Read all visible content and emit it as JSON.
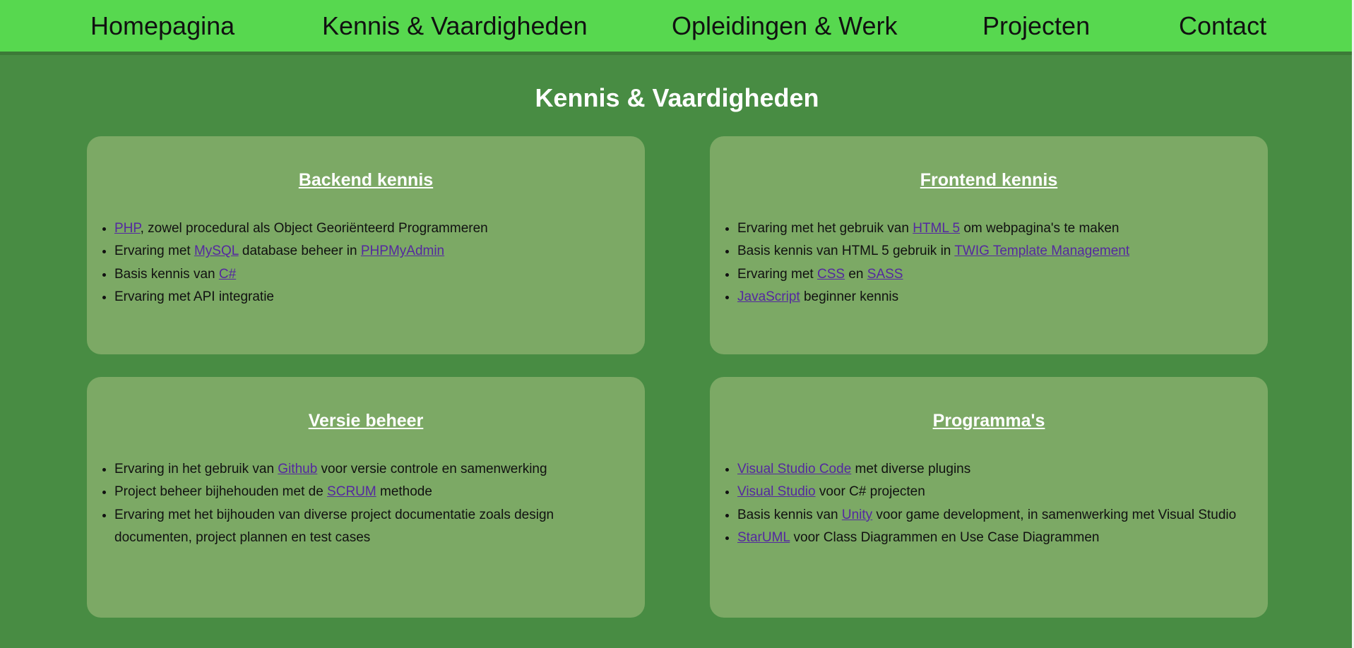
{
  "nav": {
    "items": [
      {
        "label": "Homepagina"
      },
      {
        "label": "Kennis & Vaardigheden"
      },
      {
        "label": "Opleidingen & Werk"
      },
      {
        "label": "Projecten"
      },
      {
        "label": "Contact"
      }
    ]
  },
  "page": {
    "title": "Kennis & Vaardigheden"
  },
  "cards": {
    "backend": {
      "title": "Backend kennis",
      "items": [
        {
          "link": "PHP",
          "text": ", zowel procedural als Object Georiënteerd Programmeren"
        },
        {
          "pre": "Ervaring met ",
          "link1": "MySQL",
          "mid": " database beheer in ",
          "link2": "PHPMyAdmin"
        },
        {
          "pre": "Basis kennis van ",
          "link": "C#"
        },
        {
          "text": "Ervaring met API integratie"
        }
      ]
    },
    "frontend": {
      "title": "Frontend kennis",
      "items": [
        {
          "pre": "Ervaring met het gebruik van ",
          "link": "HTML 5",
          "post": " om webpagina's te maken"
        },
        {
          "pre": "Basis kennis van HTML 5 gebruik in ",
          "link": "TWIG Template Management"
        },
        {
          "pre": "Ervaring met ",
          "link1": "CSS",
          "mid": " en ",
          "link2": "SASS"
        },
        {
          "link": "JavaScript",
          "post": " beginner kennis"
        }
      ]
    },
    "versie": {
      "title": "Versie beheer",
      "items": [
        {
          "pre": "Ervaring in het gebruik van ",
          "link": "Github",
          "post": " voor versie controle en samenwerking"
        },
        {
          "pre": "Project beheer bijhehouden met de ",
          "link": "SCRUM",
          "post": " methode"
        },
        {
          "text": "Ervaring met het bijhouden van diverse project documentatie zoals design documenten, project plannen en test cases"
        }
      ]
    },
    "programmas": {
      "title": "Programma's",
      "items": [
        {
          "link": "Visual Studio Code",
          "post": " met diverse plugins"
        },
        {
          "link": "Visual Studio",
          "post": " voor C# projecten"
        },
        {
          "pre": "Basis kennis van ",
          "link": "Unity",
          "post": " voor game development, in samenwerking met Visual Studio"
        },
        {
          "link": "StarUML",
          "post": " voor Class Diagrammen en Use Case Diagrammen"
        }
      ]
    }
  },
  "colors": {
    "nav_bg": "#57d84f",
    "page_bg": "#488c43",
    "card_bg": "#7ca965",
    "link": "#5428a0"
  }
}
